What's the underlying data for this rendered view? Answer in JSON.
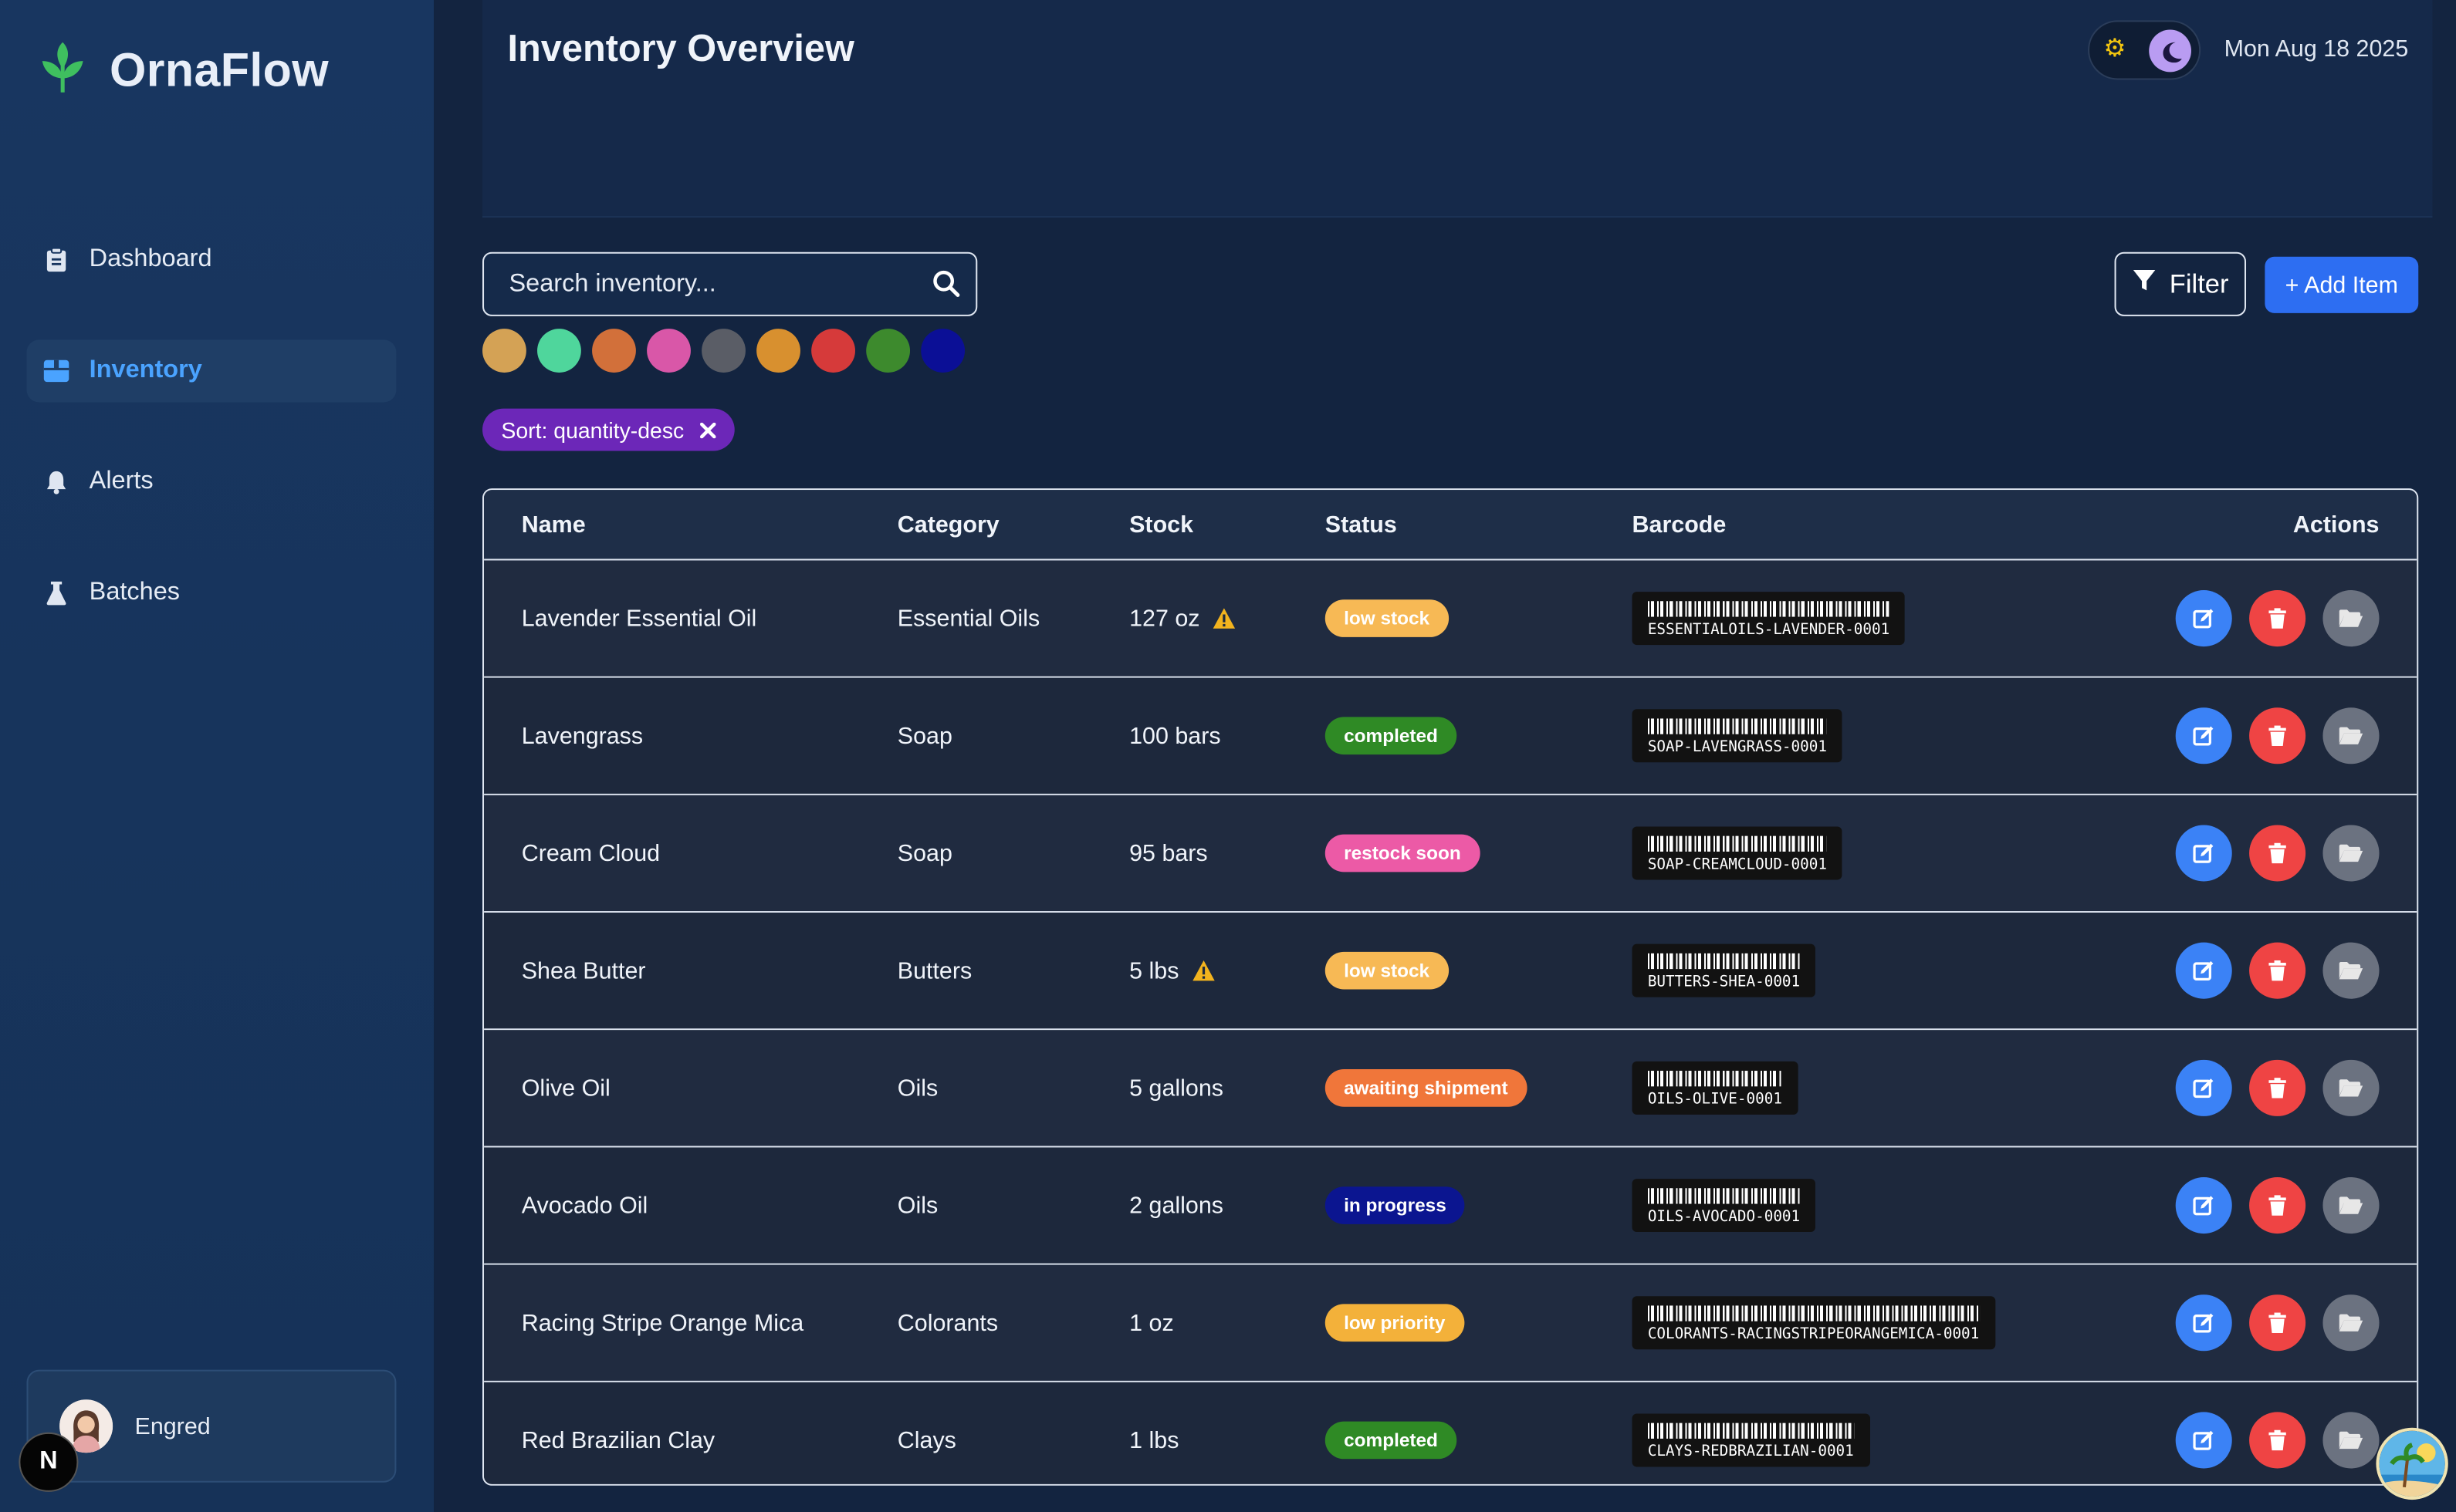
{
  "app": {
    "name": "OrnaFlow"
  },
  "sidebar": {
    "items": [
      {
        "label": "Dashboard",
        "icon": "clipboard-icon"
      },
      {
        "label": "Inventory",
        "icon": "box-icon",
        "active": true
      },
      {
        "label": "Alerts",
        "icon": "bell-icon"
      },
      {
        "label": "Batches",
        "icon": "flask-icon"
      }
    ],
    "user": {
      "name": "Engred"
    },
    "badge": "N"
  },
  "header": {
    "title": "Inventory Overview",
    "date": "Mon Aug 18 2025"
  },
  "search": {
    "placeholder": "Search inventory..."
  },
  "swatches": [
    "#d4a255",
    "#4fd69c",
    "#d2703a",
    "#d957a8",
    "#5a5d66",
    "#d8902f",
    "#d63a3a",
    "#3d8a2d",
    "#0b0f96"
  ],
  "sort_chip": {
    "label": "Sort: quantity-desc"
  },
  "toolbar": {
    "filter_label": "Filter",
    "add_label": "+ Add Item"
  },
  "table": {
    "columns": [
      "Name",
      "Category",
      "Stock",
      "Status",
      "Barcode",
      "Actions"
    ],
    "rows": [
      {
        "name": "Lavender Essential Oil",
        "category": "Essential Oils",
        "stock": "127 oz",
        "warning": true,
        "status": "low stock",
        "status_color": "#f7b955",
        "status_text_color": "#fff",
        "barcode": "ESSENTIALOILS-LAVENDER-0001"
      },
      {
        "name": "Lavengrass",
        "category": "Soap",
        "stock": "100 bars",
        "warning": false,
        "status": "completed",
        "status_color": "#2f8a25",
        "status_text_color": "#fff",
        "barcode": "SOAP-LAVENGRASS-0001"
      },
      {
        "name": "Cream Cloud",
        "category": "Soap",
        "stock": "95 bars",
        "warning": false,
        "status": "restock soon",
        "status_color": "#ec5aa6",
        "status_text_color": "#fff",
        "barcode": "SOAP-CREAMCLOUD-0001"
      },
      {
        "name": "Shea Butter",
        "category": "Butters",
        "stock": "5 lbs",
        "warning": true,
        "status": "low stock",
        "status_color": "#f7b955",
        "status_text_color": "#fff",
        "barcode": "BUTTERS-SHEA-0001"
      },
      {
        "name": "Olive Oil",
        "category": "Oils",
        "stock": "5 gallons",
        "warning": false,
        "status": "awaiting shipment",
        "status_color": "#f0763a",
        "status_text_color": "#fff",
        "barcode": "OILS-OLIVE-0001"
      },
      {
        "name": "Avocado Oil",
        "category": "Oils",
        "stock": "2 gallons",
        "warning": false,
        "status": "in progress",
        "status_color": "#0b1590",
        "status_text_color": "#fff",
        "barcode": "OILS-AVOCADO-0001"
      },
      {
        "name": "Racing Stripe Orange Mica",
        "category": "Colorants",
        "stock": "1 oz",
        "warning": false,
        "status": "low priority",
        "status_color": "#f3b13a",
        "status_text_color": "#fff",
        "barcode": "COLORANTS-RACINGSTRIPEORANGEMICA-0001"
      },
      {
        "name": "Red Brazilian Clay",
        "category": "Clays",
        "stock": "1 lbs",
        "warning": false,
        "status": "completed",
        "status_color": "#2f8a25",
        "status_text_color": "#fff",
        "barcode": "CLAYS-REDBRAZILIAN-0001"
      }
    ]
  },
  "colors": {
    "accent": "#2d6ef2",
    "sidebar_active": "#4aa3ff",
    "sort_chip": "#6c27b8"
  }
}
